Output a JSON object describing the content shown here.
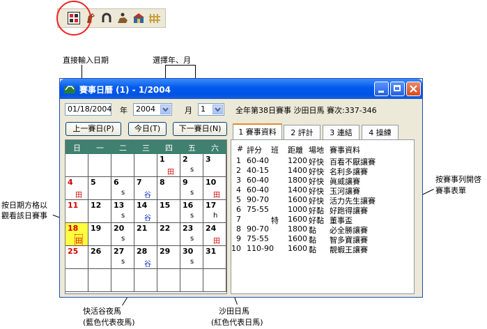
{
  "toolbar": {
    "icons": [
      "calendar-icon",
      "horse-head-icon",
      "horseshoe-icon",
      "rider-icon",
      "stable-icon",
      "fence-icon"
    ]
  },
  "annotations": {
    "date_input": "直接輸入日期",
    "year_month": "選擇年、月",
    "click_date_line1": "按日期方格以",
    "click_date_line2": "觀看該日賽事",
    "click_race_line1": "按賽事列開啓",
    "click_race_line2": "賽事表單",
    "hv_line1": "快活谷夜馬",
    "hv_line2": "(藍色代表夜馬)",
    "st_line1": "沙田日馬",
    "st_line2": "(紅色代表日馬)"
  },
  "window": {
    "title": "賽事日曆 (1) - 1/2004",
    "date_value": "01/18/2004",
    "year_label": "年",
    "year_value": "2004",
    "month_label": "月",
    "month_value": "1",
    "race_info": "全年第38日賽事 沙田日馬 賽次:337-346",
    "prev_button": "上一賽日(P)",
    "today_button": "今日(T)",
    "next_button": "下一賽日(N)"
  },
  "calendar": {
    "weekdays": [
      "日",
      "一",
      "二",
      "三",
      "四",
      "五",
      "六"
    ],
    "weeks": [
      [
        {
          "d": ""
        },
        {
          "d": ""
        },
        {
          "d": ""
        },
        {
          "d": ""
        },
        {
          "d": "1",
          "m": "田",
          "c": "st"
        },
        {
          "d": "2",
          "m": "s",
          "c": "s"
        },
        {
          "d": "3",
          "m": "",
          "c": ""
        }
      ],
      [
        {
          "d": "4",
          "m": "田",
          "c": "st",
          "red": true
        },
        {
          "d": "5"
        },
        {
          "d": "6",
          "m": "s",
          "c": "s"
        },
        {
          "d": "7",
          "m": "谷",
          "c": "hv"
        },
        {
          "d": "8"
        },
        {
          "d": "9",
          "m": "s",
          "c": "s"
        },
        {
          "d": "10",
          "m": "田",
          "c": "st"
        }
      ],
      [
        {
          "d": "11",
          "red": true
        },
        {
          "d": "12"
        },
        {
          "d": "13",
          "m": "s",
          "c": "s"
        },
        {
          "d": "14",
          "m": "谷",
          "c": "hv"
        },
        {
          "d": "15"
        },
        {
          "d": "16",
          "m": "s",
          "c": "s"
        },
        {
          "d": "17",
          "m": "h",
          "c": "s"
        }
      ],
      [
        {
          "d": "18",
          "m": "田",
          "c": "st",
          "red": true,
          "sel": true
        },
        {
          "d": "19"
        },
        {
          "d": "20",
          "m": "s",
          "c": "s"
        },
        {
          "d": "21"
        },
        {
          "d": "22"
        },
        {
          "d": "23",
          "m": "s",
          "c": "s"
        },
        {
          "d": "24",
          "m": "田",
          "c": "st"
        }
      ],
      [
        {
          "d": "25",
          "red": true
        },
        {
          "d": "26"
        },
        {
          "d": "27",
          "m": "s",
          "c": "s"
        },
        {
          "d": "28",
          "m": "谷",
          "c": "hv"
        },
        {
          "d": "29"
        },
        {
          "d": "30",
          "m": "s",
          "c": "s"
        },
        {
          "d": "31"
        }
      ],
      [
        {
          "d": ""
        },
        {
          "d": ""
        },
        {
          "d": ""
        },
        {
          "d": ""
        },
        {
          "d": ""
        },
        {
          "d": ""
        },
        {
          "d": ""
        }
      ]
    ]
  },
  "tabs": [
    "1 賽事資料",
    "2 評計",
    "3 連結",
    "4 操練"
  ],
  "races": {
    "headers": [
      "#",
      "評分",
      "班",
      "距離",
      "場地",
      "賽事資料"
    ],
    "rows": [
      [
        "1",
        "60-40",
        "",
        "1200",
        "好快",
        "百看不厭讓賽"
      ],
      [
        "2",
        "40-15",
        "",
        "1400",
        "好快",
        "名利多讓賽"
      ],
      [
        "3",
        "60-40",
        "",
        "1800",
        "好快",
        "眞威讓賽"
      ],
      [
        "4",
        "60-40",
        "",
        "1400",
        "好快",
        "玉河讓賽"
      ],
      [
        "5",
        "90-70",
        "",
        "1600",
        "好快",
        "活力先生讓賽"
      ],
      [
        "6",
        "75-55",
        "",
        "1000",
        "好黏",
        "好跑得讓賽"
      ],
      [
        "7",
        "",
        "特",
        "1600",
        "好黏",
        "董事盃"
      ],
      [
        "8",
        "90-70",
        "",
        "1800",
        "黏",
        "必全勝讓賽"
      ],
      [
        "9",
        "75-55",
        "",
        "1600",
        "黏",
        "智多寶讓賽"
      ],
      [
        "10",
        "110-90",
        "",
        "1600",
        "黏",
        "靚蝦王讓賽"
      ]
    ]
  },
  "colors": {
    "sha_tin": "#d40000",
    "happy_valley": "#1030c0",
    "selected": "#ffff40",
    "header": "#3f8070"
  }
}
